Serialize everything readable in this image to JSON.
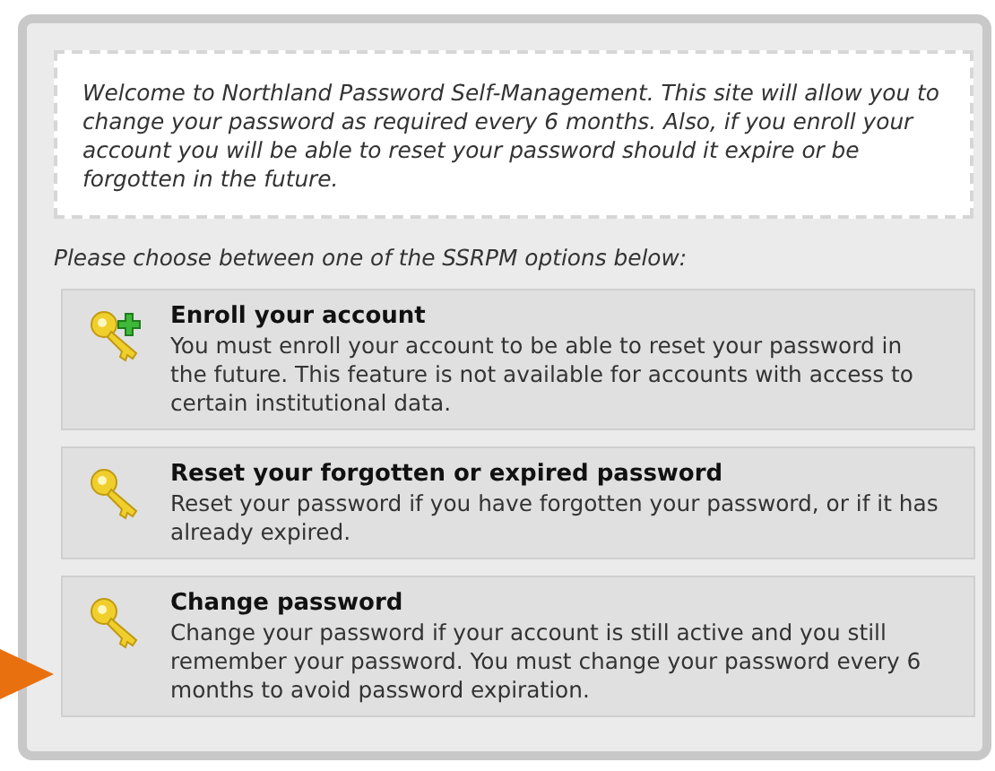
{
  "intro": "Welcome to Northland Password Self-Management. This site will allow you to change your password as required every 6 months. Also, if you enroll your account you will be able to reset your password should it expire or be forgotten in the future.",
  "prompt": "Please choose between one of the SSRPM options below:",
  "options": [
    {
      "kind": "enroll",
      "title": "Enroll your account",
      "description": "You must enroll your account to be able to reset your password in the future. This feature is not available for accounts with access to certain institutional data.",
      "pointed": false
    },
    {
      "kind": "key",
      "title": "Reset your forgotten or expired password",
      "description": "Reset your password if you have forgotten your password, or if it has already expired.",
      "pointed": false
    },
    {
      "kind": "key",
      "title": "Change password",
      "description": "Change your password if your account is still active and you still remember your password. You must change your password every 6 months to avoid password expiration.",
      "pointed": true
    }
  ]
}
